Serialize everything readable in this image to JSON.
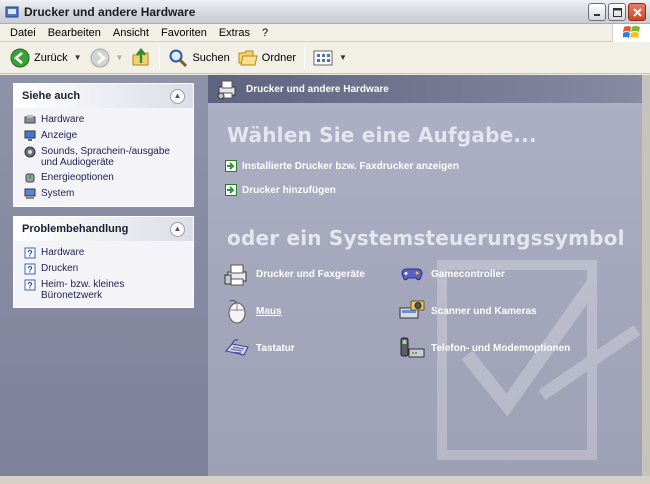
{
  "window": {
    "title": "Drucker und andere Hardware"
  },
  "menu": [
    "Datei",
    "Bearbeiten",
    "Ansicht",
    "Favoriten",
    "Extras",
    "?"
  ],
  "toolbar": {
    "back_label": "Zurück",
    "search_label": "Suchen",
    "folders_label": "Ordner"
  },
  "sidebar": {
    "see_also": {
      "title": "Siehe auch",
      "items": [
        {
          "label": "Hardware",
          "icon": "hardware-icon"
        },
        {
          "label": "Anzeige",
          "icon": "display-icon"
        },
        {
          "label": "Sounds, Sprachein-/ausgabe und Audiogeräte",
          "icon": "sound-icon"
        },
        {
          "label": "Energieoptionen",
          "icon": "power-icon"
        },
        {
          "label": "System",
          "icon": "system-icon"
        }
      ]
    },
    "troubleshoot": {
      "title": "Problembehandlung",
      "items": [
        {
          "label": "Hardware",
          "icon": "help-icon"
        },
        {
          "label": "Drucken",
          "icon": "help-icon"
        },
        {
          "label": "Heim- bzw. kleines Büronetzwerk",
          "icon": "help-icon"
        }
      ]
    }
  },
  "main": {
    "header_title": "Drucker und andere Hardware",
    "task_heading": "Wählen Sie eine Aufgabe...",
    "tasks": [
      "Installierte Drucker bzw. Faxdrucker anzeigen",
      "Drucker hinzufügen"
    ],
    "icon_heading": "oder ein Systemsteuerungssymbol",
    "categories": [
      {
        "label": "Drucker und Faxgeräte",
        "icon": "printer-fax-icon"
      },
      {
        "label": "Gamecontroller",
        "icon": "gamecontroller-icon"
      },
      {
        "label": "Maus",
        "icon": "mouse-icon"
      },
      {
        "label": "Scanner und Kameras",
        "icon": "scanner-camera-icon"
      },
      {
        "label": "Tastatur",
        "icon": "keyboard-icon"
      },
      {
        "label": "Telefon- und Modemoptionen",
        "icon": "phone-modem-icon"
      }
    ]
  },
  "colors": {
    "sidebar_bg": "#858aa2",
    "main_bg": "#a8abc0",
    "header_bg": "#6a6f8c",
    "task_arrow_green": "#2f9a2f"
  }
}
